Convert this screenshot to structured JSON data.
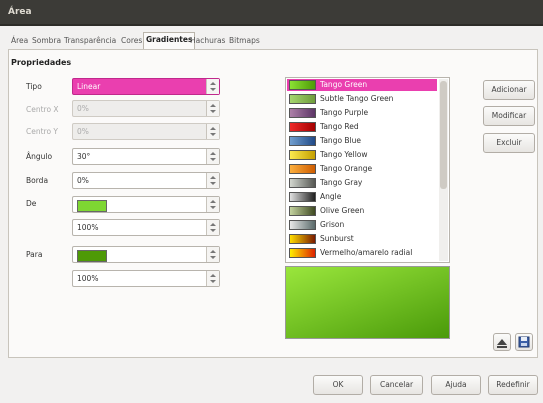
{
  "window": {
    "title": "Área"
  },
  "tabs": [
    "Área",
    "Sombra",
    "Transparência",
    "Cores",
    "Gradientes",
    "Hachuras",
    "Bitmaps"
  ],
  "active_tab": "Gradientes",
  "section": "Propriedades",
  "fields": {
    "tipo": {
      "label": "Tipo",
      "value": "Linear"
    },
    "centro_x": {
      "label": "Centro X",
      "value": "0%"
    },
    "centro_y": {
      "label": "Centro Y",
      "value": "0%"
    },
    "angulo": {
      "label": "Ângulo",
      "value": "30°"
    },
    "borda": {
      "label": "Borda",
      "value": "0%"
    },
    "de": {
      "label": "De",
      "color": "#7ed732",
      "percent": "100%"
    },
    "para": {
      "label": "Para",
      "color": "#4e9a06",
      "percent": "100%"
    }
  },
  "gradients": [
    {
      "name": "Tango Green",
      "c1": "#8ae234",
      "c2": "#4e9a06",
      "selected": true
    },
    {
      "name": "Subtle Tango Green",
      "c1": "#a6d66f",
      "c2": "#6e9c3c"
    },
    {
      "name": "Tango Purple",
      "c1": "#ad7fa8",
      "c2": "#5c3566"
    },
    {
      "name": "Tango Red",
      "c1": "#ef2929",
      "c2": "#a40000"
    },
    {
      "name": "Tango Blue",
      "c1": "#729fcf",
      "c2": "#204a87"
    },
    {
      "name": "Tango Yellow",
      "c1": "#fce94f",
      "c2": "#c4a000"
    },
    {
      "name": "Tango Orange",
      "c1": "#fcaf3e",
      "c2": "#ce5c00"
    },
    {
      "name": "Tango Gray",
      "c1": "#d3d7cf",
      "c2": "#555753"
    },
    {
      "name": "Angle",
      "c1": "#e0e0e0",
      "c2": "#202020"
    },
    {
      "name": "Olive Green",
      "c1": "#c4d3a0",
      "c2": "#3f4a22"
    },
    {
      "name": "Grison",
      "c1": "#e8e8e8",
      "c2": "#5a6a6a"
    },
    {
      "name": "Sunburst",
      "c1": "#ffdd00",
      "c2": "#7a1a00"
    },
    {
      "name": "Vermelho/amarelo radial",
      "c1": "#ffee00",
      "c2": "#dd2200"
    }
  ],
  "preview": {
    "c1": "#9ae63c",
    "c2": "#4a9a0a"
  },
  "side_buttons": {
    "add": "Adicionar",
    "modify": "Modificar",
    "delete": "Excluir"
  },
  "icons": {
    "load": "load-icon",
    "save": "save-icon"
  },
  "footer": {
    "ok": "OK",
    "cancel": "Cancelar",
    "help": "Ajuda",
    "reset": "Redefinir"
  }
}
